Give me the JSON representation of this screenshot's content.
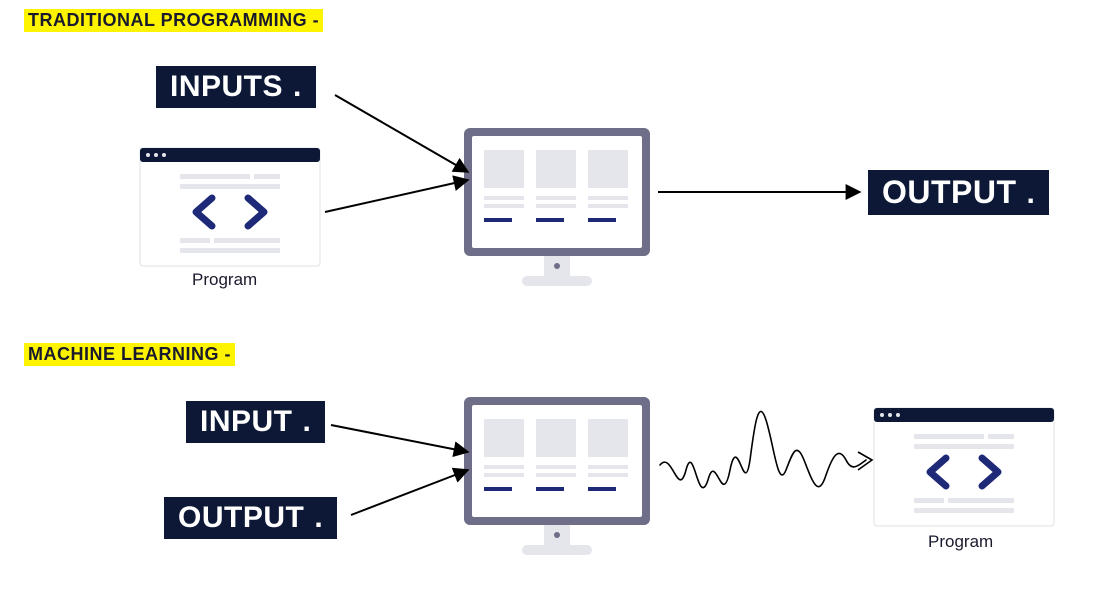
{
  "section1": {
    "heading": "TRADITIONAL PROGRAMMING -",
    "inputs_label": "INPUTS",
    "inputs_dot": ".",
    "program_caption": "Program",
    "output_label": "OUTPUT",
    "output_dot": "."
  },
  "section2": {
    "heading": "MACHINE LEARNING -",
    "input_label": "INPUT",
    "input_dot": ".",
    "output_label": "OUTPUT",
    "output_dot": ".",
    "program_caption": "Program"
  },
  "colors": {
    "highlight": "#fff400",
    "dark": "#0d1836",
    "accent": "#1e2a78",
    "grey_light": "#e4e6eb",
    "grey_frame": "#6e6e88"
  }
}
